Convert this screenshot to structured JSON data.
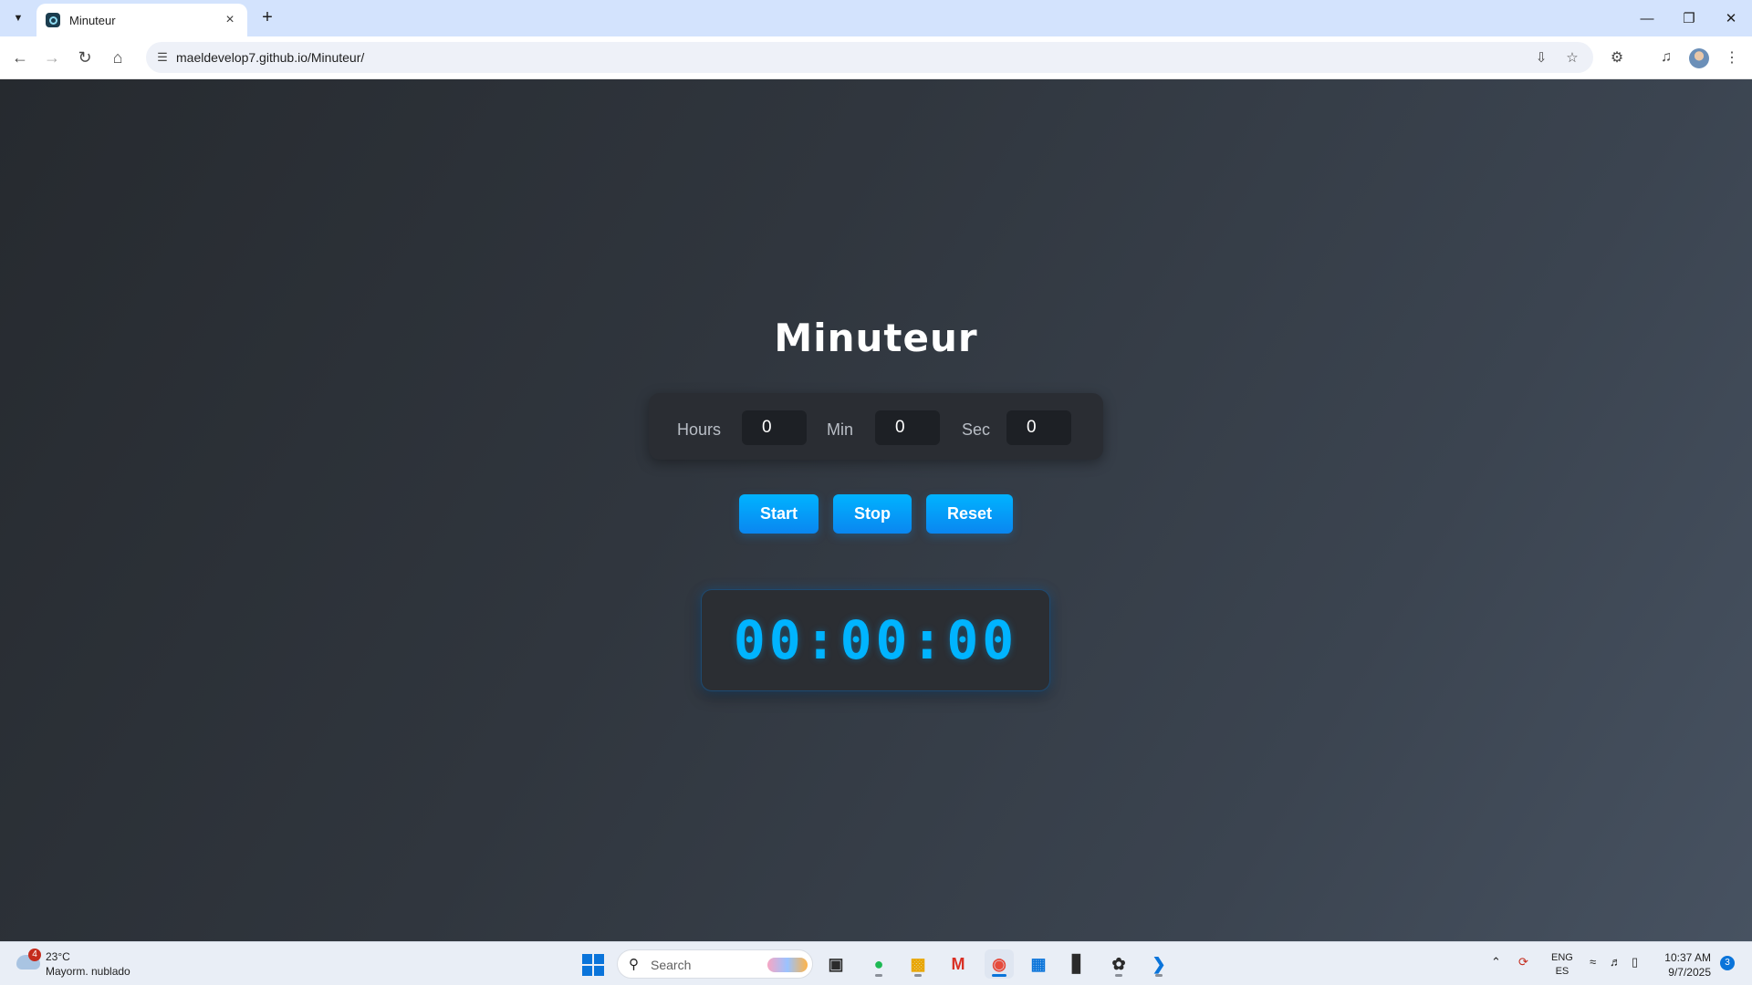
{
  "browser": {
    "tab_title": "Minuteur",
    "new_tab_label": "+",
    "url": "maeldevelop7.github.io/Minuteur/",
    "icons": [
      "tab-search-icon",
      "close-icon",
      "minimize-icon",
      "maximize-icon",
      "back-icon",
      "forward-icon",
      "reload-icon",
      "home-icon",
      "site-info-icon",
      "install-icon",
      "bookmark-star-icon",
      "extensions-icon",
      "media-control-icon",
      "profile-avatar",
      "more-menu-icon"
    ]
  },
  "page": {
    "title": "Minuteur",
    "inputs": {
      "hours_label": "Hours",
      "hours_value": "0",
      "min_label": "Min",
      "min_value": "0",
      "sec_label": "Sec",
      "sec_value": "0"
    },
    "buttons": {
      "start": "Start",
      "stop": "Stop",
      "reset": "Reset"
    },
    "display": "00:00:00",
    "colors": {
      "accent": "#00b4ff",
      "button": "#0a86f0",
      "panel": "#2a2d33"
    }
  },
  "taskbar": {
    "weather": {
      "badge": "4",
      "temp": "23°C",
      "desc": "Mayorm. nublado"
    },
    "search_placeholder": "Search",
    "apps": [
      "file-explorer-icon",
      "spotify-icon",
      "folder-icon",
      "gmail-icon",
      "chrome-icon",
      "store-icon",
      "terminal-icon",
      "chatgpt-icon",
      "vscode-icon"
    ],
    "lang_line1": "ENG",
    "lang_line2": "ES",
    "time": "10:37 AM",
    "date": "9/7/2025",
    "notification_count": "3"
  }
}
